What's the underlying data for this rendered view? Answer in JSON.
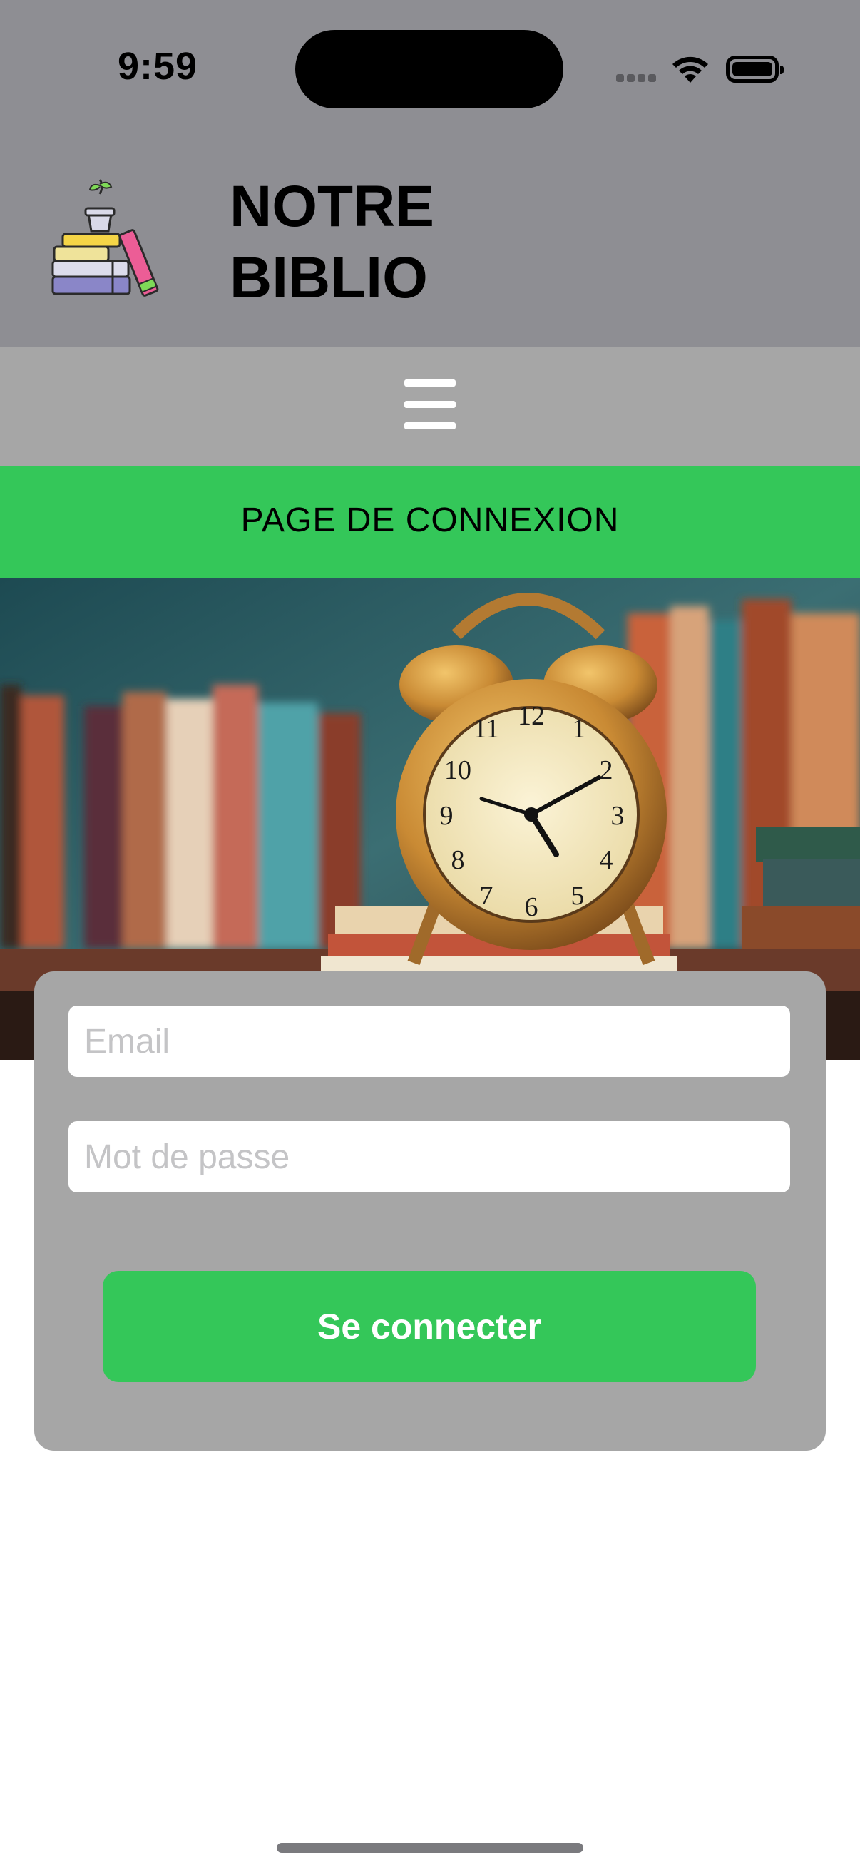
{
  "status_bar": {
    "time": "9:59"
  },
  "header": {
    "brand_line1": "NOTRE",
    "brand_line2": "BIBLIO",
    "logo_icon": "books-plant-icon"
  },
  "nav": {
    "menu_icon": "hamburger-icon"
  },
  "page": {
    "title": "PAGE DE CONNEXION"
  },
  "hero": {
    "image": "alarm-clock-books-photo"
  },
  "login_form": {
    "email_placeholder": "Email",
    "email_value": "",
    "password_placeholder": "Mot de passe",
    "password_value": "",
    "submit_label": "Se connecter"
  },
  "colors": {
    "header_bg": "#8e8e93",
    "menu_bg": "#a6a6a6",
    "accent_green": "#34c759",
    "card_bg": "#a6a6a6"
  }
}
